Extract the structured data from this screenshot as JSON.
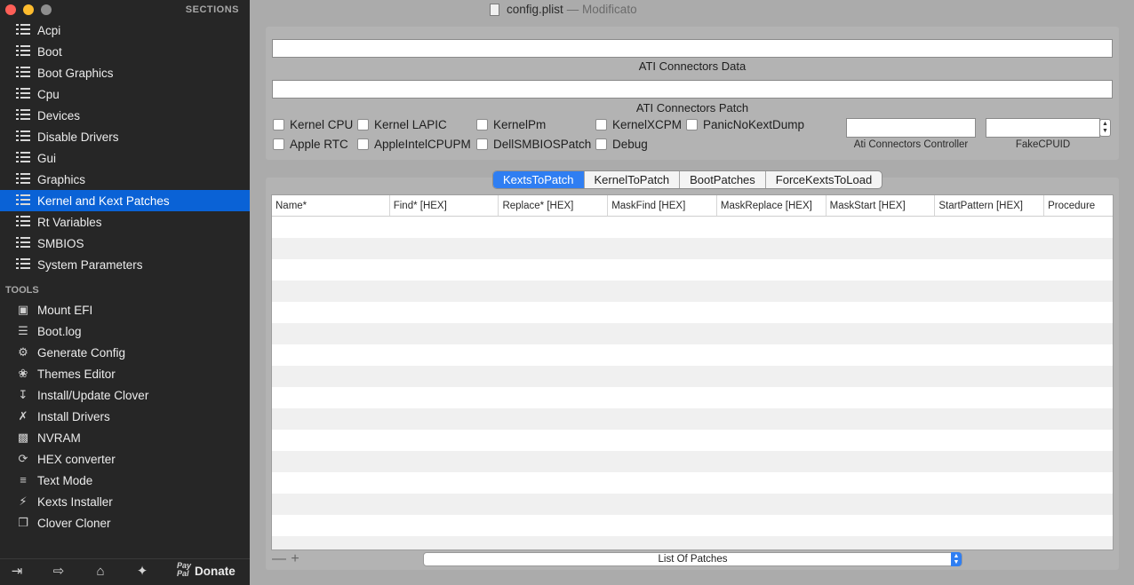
{
  "window": {
    "title": "config.plist",
    "status": "— Modificato"
  },
  "sidebar": {
    "sections_header": "SECTIONS",
    "sections": [
      {
        "label": "Acpi"
      },
      {
        "label": "Boot"
      },
      {
        "label": "Boot Graphics"
      },
      {
        "label": "Cpu"
      },
      {
        "label": "Devices"
      },
      {
        "label": "Disable Drivers"
      },
      {
        "label": "Gui"
      },
      {
        "label": "Graphics"
      },
      {
        "label": "Kernel and Kext Patches",
        "active": true
      },
      {
        "label": "Rt Variables"
      },
      {
        "label": "SMBIOS"
      },
      {
        "label": "System Parameters"
      }
    ],
    "tools_header": "TOOLS",
    "tools": [
      {
        "label": "Mount EFI",
        "icon": "disk-icon"
      },
      {
        "label": "Boot.log",
        "icon": "log-search-icon"
      },
      {
        "label": "Generate Config",
        "icon": "gears-icon"
      },
      {
        "label": "Themes Editor",
        "icon": "palette-icon"
      },
      {
        "label": "Install/Update Clover",
        "icon": "download-icon"
      },
      {
        "label": "Install Drivers",
        "icon": "tools-icon"
      },
      {
        "label": "NVRAM",
        "icon": "chip-icon"
      },
      {
        "label": "HEX converter",
        "icon": "refresh-icon"
      },
      {
        "label": "Text Mode",
        "icon": "text-lines-icon"
      },
      {
        "label": "Kexts Installer",
        "icon": "plug-icon"
      },
      {
        "label": "Clover Cloner",
        "icon": "clone-icon"
      }
    ],
    "bottom": {
      "paypal_top": "Pay",
      "paypal_bottom": "Pal",
      "donate": "Donate"
    }
  },
  "top_panel": {
    "ati_connectors_data_label": "ATI Connectors Data",
    "ati_connectors_data_value": "",
    "ati_connectors_patch_label": "ATI Connectors Patch",
    "ati_connectors_patch_value": "",
    "checkboxes_row1": [
      "Kernel CPU",
      "Kernel LAPIC",
      "KernelPm",
      "KernelXCPM",
      "PanicNoKextDump"
    ],
    "checkboxes_row2": [
      "Apple RTC",
      "AppleIntelCPUPM",
      "DellSMBIOSPatch",
      "Debug"
    ],
    "ati_controller_label": "Ati Connectors Controller",
    "ati_controller_value": "",
    "fakecpuid_label": "FakeCPUID",
    "fakecpuid_value": ""
  },
  "tabs": [
    "KextsToPatch",
    "KernelToPatch",
    "BootPatches",
    "ForceKextsToLoad"
  ],
  "active_tab": "KextsToPatch",
  "table": {
    "columns": [
      "Name*",
      "Find* [HEX]",
      "Replace* [HEX]",
      "MaskFind [HEX]",
      "MaskReplace [HEX]",
      "MaskStart [HEX]",
      "StartPattern [HEX]",
      "Procedure"
    ],
    "rows": []
  },
  "footer": {
    "remove_symbol": "—",
    "add_symbol": "+",
    "list_popup": "List Of Patches"
  }
}
